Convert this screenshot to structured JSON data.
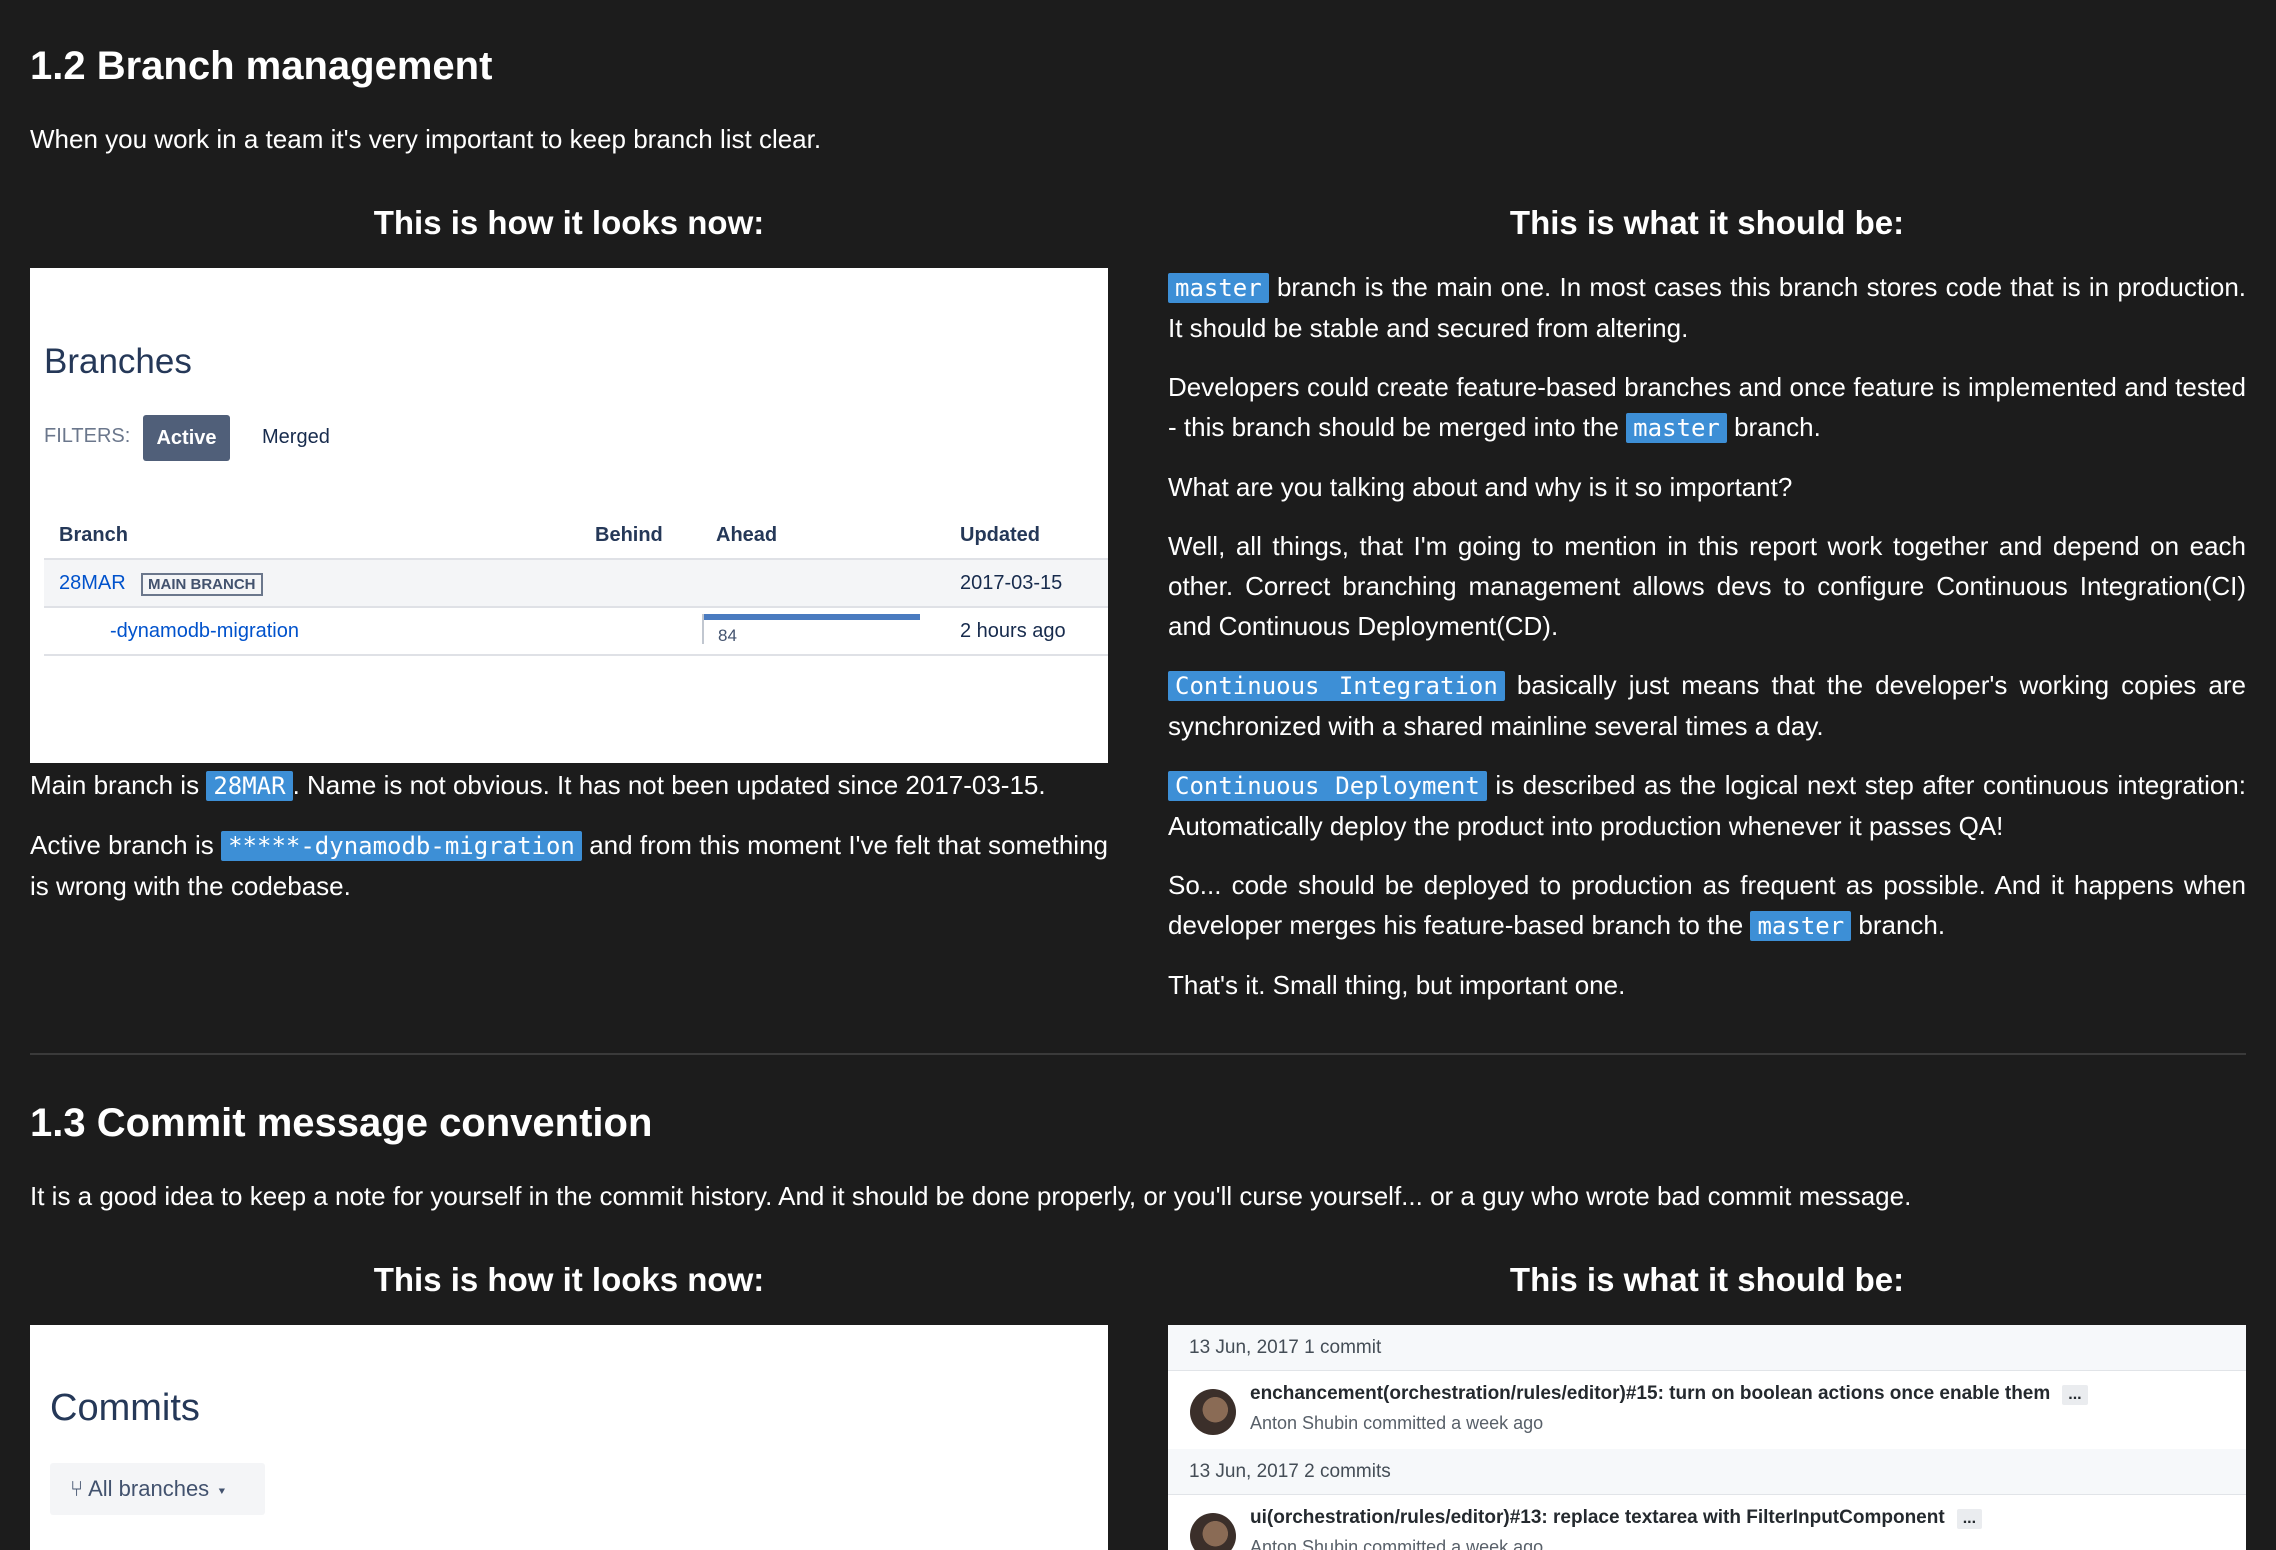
{
  "section_12": {
    "heading": "1.2 Branch management",
    "intro": "When you work in a team it's very important to keep branch list clear.",
    "left_title": "This is how it looks now:",
    "right_title": "This is what it should be:",
    "screenshot": {
      "title": "Branches",
      "filters_label": "FILTERS:",
      "filter_active": "Active",
      "filter_merged": "Merged",
      "columns": {
        "branch": "Branch",
        "behind": "Behind",
        "ahead": "Ahead",
        "updated": "Updated"
      },
      "rows": [
        {
          "branch": "28MAR",
          "badge": "MAIN BRANCH",
          "updated": "2017-03-15"
        },
        {
          "branch": "-dynamodb-migration",
          "ahead": "84",
          "ahead_fraction": 1.0,
          "updated": "2 hours ago"
        }
      ]
    },
    "left_p1": {
      "a": "Main branch is ",
      "code": "28MAR",
      "b": ". Name is not obvious. It has not been updated since 2017-03-15."
    },
    "left_p2": {
      "a": "Active branch is ",
      "code": "*****-dynamodb-migration",
      "b": " and from this moment I've felt that something is wrong with the codebase."
    },
    "right_p1": {
      "code": "master",
      "b": " branch is the main one. In most cases this branch stores code that is in production. It should be stable and secured from altering."
    },
    "right_p2": {
      "a": "Developers could create feature-based branches and once feature is implemented and tested - this branch should be merged into the ",
      "code": "master",
      "b": " branch."
    },
    "right_p3": "What are you talking about and why is it so important?",
    "right_p4": "Well, all things, that I'm going to mention in this report work together and depend on each other. Correct branching management allows devs to configure Continuous Integration(CI) and Continuous Deployment(CD).",
    "right_p5": {
      "code": "Continuous Integration",
      "b": " basically just means that the developer's working copies are synchronized with a shared mainline several times a day."
    },
    "right_p6": {
      "code": "Continuous Deployment",
      "b": " is described as the logical next step after continuous integration: Automatically deploy the product into production whenever it passes QA!"
    },
    "right_p7": {
      "a": "So... code should be deployed to production as frequent as possible. And it happens when developer merges his feature-based branch to the ",
      "code": "master",
      "b": " branch."
    },
    "right_p8": "That's it. Small thing, but important one."
  },
  "section_13": {
    "heading": "1.3 Commit message convention",
    "intro": "It is a good idea to keep a note for yourself in the commit history. And it should be done properly, or you'll curse yourself... or a guy who wrote bad commit message.",
    "left_title": "This is how it looks now:",
    "right_title": "This is what it should be:",
    "left_shot": {
      "title": "Commits",
      "branches_button": "All branches"
    },
    "right_shot": {
      "groups": [
        {
          "day": "13 Jun, 2017 1 commit",
          "message": "enchancement(orchestration/rules/editor)#15: turn on boolean actions once enable them",
          "author": "Anton Shubin committed a week ago"
        },
        {
          "day": "13 Jun, 2017 2 commits",
          "message": "ui(orchestration/rules/editor)#13: replace textarea with FilterInputComponent",
          "author": "Anton Shubin committed a week ago"
        }
      ],
      "ellipsis": "..."
    }
  },
  "colors": {
    "background": "#1c1c1c",
    "code_tag": "#3d8fd6",
    "link": "#0052cc"
  }
}
